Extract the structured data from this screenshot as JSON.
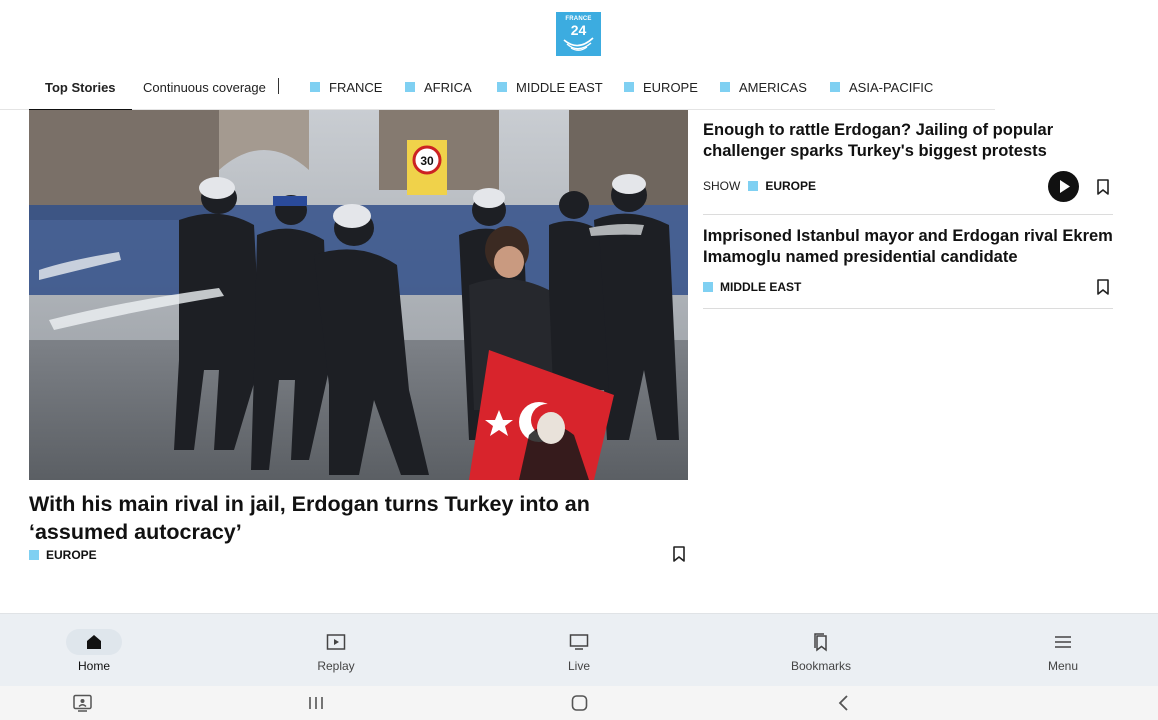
{
  "header": {
    "logo_brand": "FRANCE",
    "logo_number": "24"
  },
  "nav": {
    "items": [
      {
        "label": "Top Stories"
      },
      {
        "label": "Continuous coverage"
      },
      {
        "label": "FRANCE"
      },
      {
        "label": "AFRICA"
      },
      {
        "label": "MIDDLE EAST"
      },
      {
        "label": "EUROPE"
      },
      {
        "label": "AMERICAS"
      },
      {
        "label": "ASIA-PACIFIC"
      }
    ],
    "section_color": "#7fd0f2"
  },
  "hero": {
    "title": "With his main rival in jail, Erdogan turns Turkey into an ‘assumed autocracy’",
    "tag": "EUROPE"
  },
  "stories": [
    {
      "title": "Enough to rattle Erdogan? Jailing of popular challenger sparks Turkey's biggest protests",
      "show_label": "SHOW",
      "tag": "EUROPE"
    },
    {
      "title": "Imprisoned Istanbul mayor and Erdogan rival Ekrem Imamoglu named presidential candidate",
      "tag": "MIDDLE EAST"
    }
  ],
  "tabbar": {
    "items": [
      {
        "label": "Home",
        "icon": "home-icon"
      },
      {
        "label": "Replay",
        "icon": "replay-icon"
      },
      {
        "label": "Live",
        "icon": "live-tv-icon"
      },
      {
        "label": "Bookmarks",
        "icon": "bookmarks-icon"
      },
      {
        "label": "Menu",
        "icon": "menu-icon"
      }
    ]
  },
  "colors": {
    "accent": "#3cace0",
    "tabbar_bg": "#ebeff3"
  }
}
